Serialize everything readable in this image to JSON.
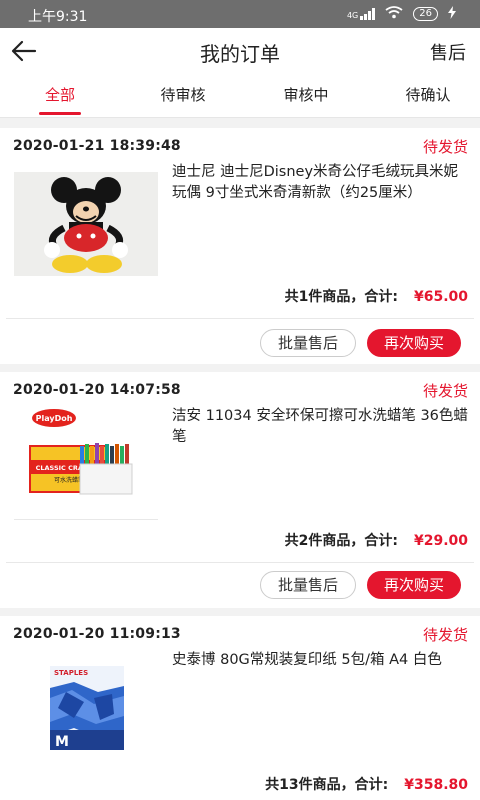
{
  "status_bar": {
    "time": "上午9:31",
    "network": "4G",
    "battery": "26"
  },
  "header": {
    "title": "我的订单",
    "right_label": "售后"
  },
  "tabs": [
    {
      "label": "全部",
      "active": true
    },
    {
      "label": "待审核",
      "active": false
    },
    {
      "label": "审核中",
      "active": false
    },
    {
      "label": "待确认",
      "active": false
    }
  ],
  "orders": [
    {
      "date": "2020-01-21 18:39:48",
      "status": "待发货",
      "product_name": "迪士尼 迪士尼Disney米奇公仔毛绒玩具米妮玩偶 9寸坐式米奇清新款（约25厘米）",
      "count_text": "共1件商品，合计:",
      "total": "¥65.00",
      "btn_after_sales": "批量售后",
      "btn_rebuy": "再次购买"
    },
    {
      "date": "2020-01-20 14:07:58",
      "status": "待发货",
      "product_name": "洁安 11034 安全环保可擦可水洗蜡笔 36色蜡笔",
      "count_text": "共2件商品，合计:",
      "total": "¥29.00",
      "btn_after_sales": "批量售后",
      "btn_rebuy": "再次购买",
      "image_texts": {
        "brand": "PlayDoh",
        "label": "CLASSIC CRAYONS",
        "sub": "可水洗蜡笔"
      }
    },
    {
      "date": "2020-01-20 11:09:13",
      "status": "待发货",
      "product_name": "史泰博 80G常规装复印纸 5包/箱 A4 白色",
      "count_text": "共13件商品，合计:",
      "total": "¥358.80",
      "image_texts": {
        "brand": "STAPLES",
        "letter": "M"
      }
    }
  ],
  "colors": {
    "accent": "#e4162e",
    "status_bar": "#6e6e6e",
    "background": "#f2f2f2"
  }
}
